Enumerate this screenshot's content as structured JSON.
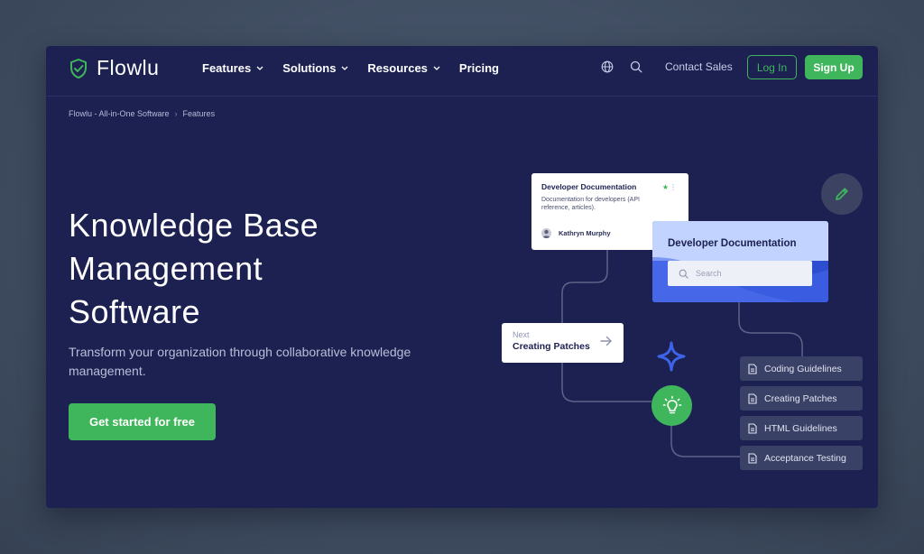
{
  "brand": {
    "name": "Flowlu",
    "accent": "#3fb65b",
    "background": "#1c2152"
  },
  "nav": {
    "items": [
      {
        "label": "Features",
        "has_dropdown": true
      },
      {
        "label": "Solutions",
        "has_dropdown": true
      },
      {
        "label": "Resources",
        "has_dropdown": true
      },
      {
        "label": "Pricing",
        "has_dropdown": false
      }
    ],
    "icons": [
      "globe-icon",
      "search-icon"
    ],
    "contact_label": "Contact Sales",
    "login_label": "Log In",
    "signup_label": "Sign Up"
  },
  "breadcrumb": {
    "items": [
      "Flowlu - All-in-One Software",
      "Features"
    ],
    "separator": "›"
  },
  "hero": {
    "title_lines": [
      "Knowledge Base",
      "Management",
      "Software"
    ],
    "subtitle": "Transform your organization through collaborative knowledge management.",
    "cta_label": "Get started for free"
  },
  "illustration": {
    "doc_card": {
      "title": "Developer Documentation",
      "description": "Documentation for developers (API reference, articles).",
      "author": "Kathryn Murphy"
    },
    "blue_card": {
      "title": "Developer Documentation",
      "search_placeholder": "Search"
    },
    "next_card": {
      "label": "Next",
      "title": "Creating Patches"
    },
    "doc_list": [
      "Coding Guidelines",
      "Creating Patches",
      "HTML Guidelines",
      "Acceptance Testing"
    ],
    "icons": [
      "pencil-icon",
      "sparkle-icon",
      "lightbulb-icon"
    ]
  }
}
